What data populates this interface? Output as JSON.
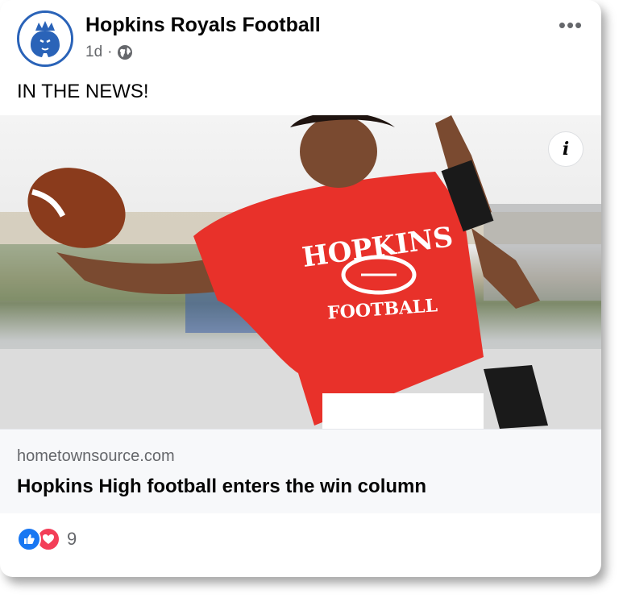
{
  "post": {
    "page_name": "Hopkins Royals Football",
    "timestamp": "1d",
    "separator": "·",
    "audience_icon": "globe-icon",
    "more_icon": "ellipsis-icon",
    "more_label": "•••",
    "caption": "IN THE NEWS!"
  },
  "link_preview": {
    "image_description_icon": "info-icon",
    "info_label": "i",
    "jersey_text_top": "HOPKINS",
    "jersey_text_bottom": "FOOTBALL",
    "domain": "hometownsource.com",
    "title": "Hopkins High football enters the win column"
  },
  "reactions": {
    "icons": [
      "like-icon",
      "love-icon"
    ],
    "count": "9"
  },
  "colors": {
    "brand_blue": "#1877f2",
    "love_red": "#f33e58",
    "avatar_blue": "#2a63b8",
    "jersey_red": "#e8312a",
    "text_primary": "#050505",
    "text_secondary": "#65676b"
  }
}
